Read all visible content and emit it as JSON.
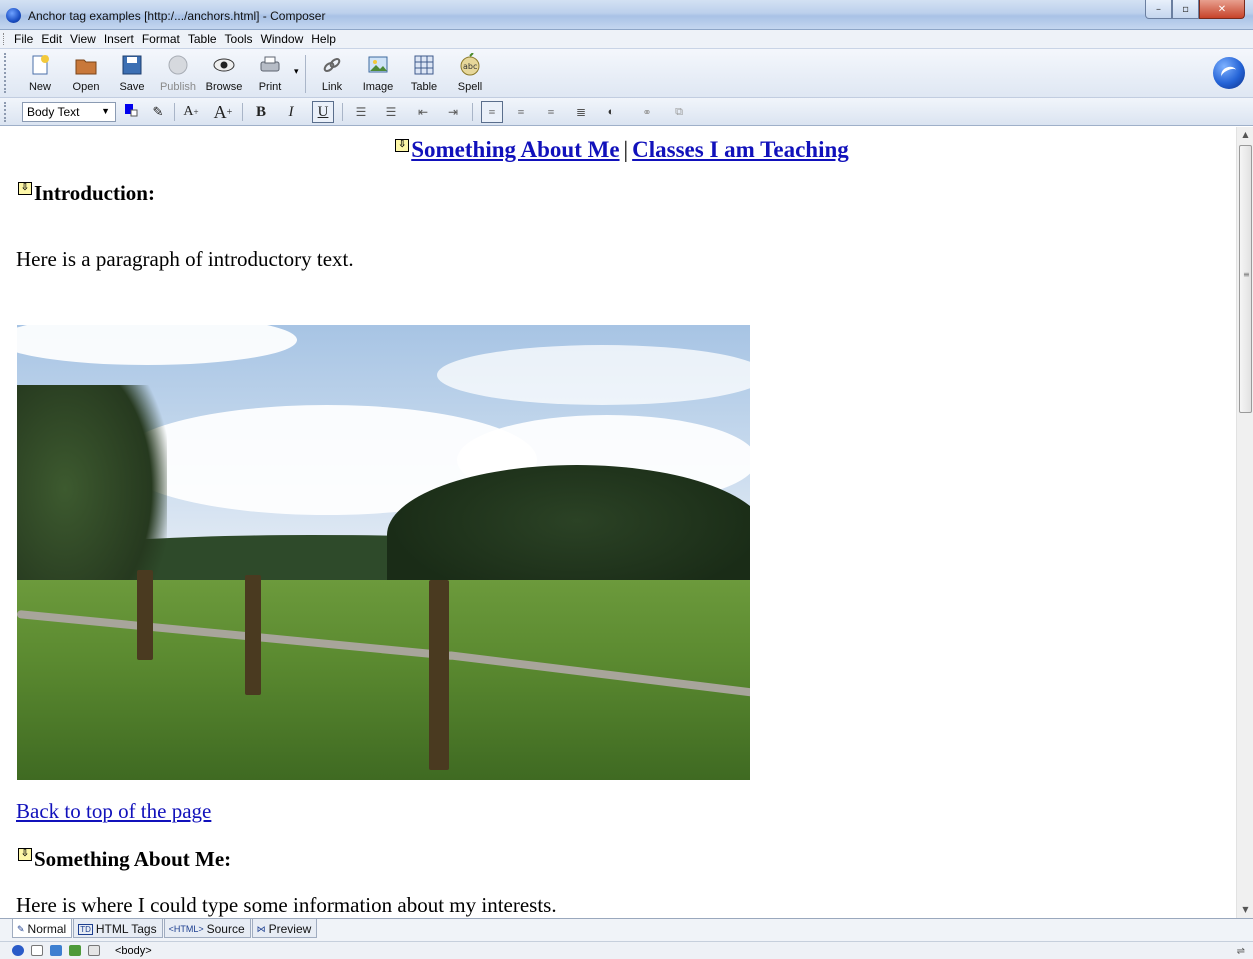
{
  "window": {
    "title": "Anchor tag examples [http:/.../anchors.html] - Composer",
    "minimize": "–",
    "maximize": "▫",
    "close": "✕"
  },
  "menu": [
    "File",
    "Edit",
    "View",
    "Insert",
    "Format",
    "Table",
    "Tools",
    "Window",
    "Help"
  ],
  "toolbar": {
    "new": "New",
    "open": "Open",
    "save": "Save",
    "publish": "Publish",
    "browse": "Browse",
    "print": "Print",
    "link": "Link",
    "image": "Image",
    "table": "Table",
    "spell": "Spell"
  },
  "format": {
    "paragraph_style": "Body Text",
    "text_color": "#0000ee",
    "smaller": "A",
    "larger": "A",
    "bold": "B",
    "italic": "I",
    "underline": "U"
  },
  "document": {
    "nav_link_1": "Something About Me",
    "nav_separator": "|",
    "nav_link_2": "Classes I am Teaching",
    "heading_intro": "Introduction:",
    "para_intro": "Here is a paragraph of introductory text.",
    "back_link": "Back to top of the page",
    "heading_about": "Something About Me:",
    "para_about": "Here is where I could type some information about my interests."
  },
  "tabs": {
    "normal": "Normal",
    "html_tags": "HTML Tags",
    "source": "Source",
    "preview": "Preview",
    "html_tags_icon_text": "TD",
    "source_icon_text": "<HTML>"
  },
  "status": {
    "tag": "<body>"
  }
}
